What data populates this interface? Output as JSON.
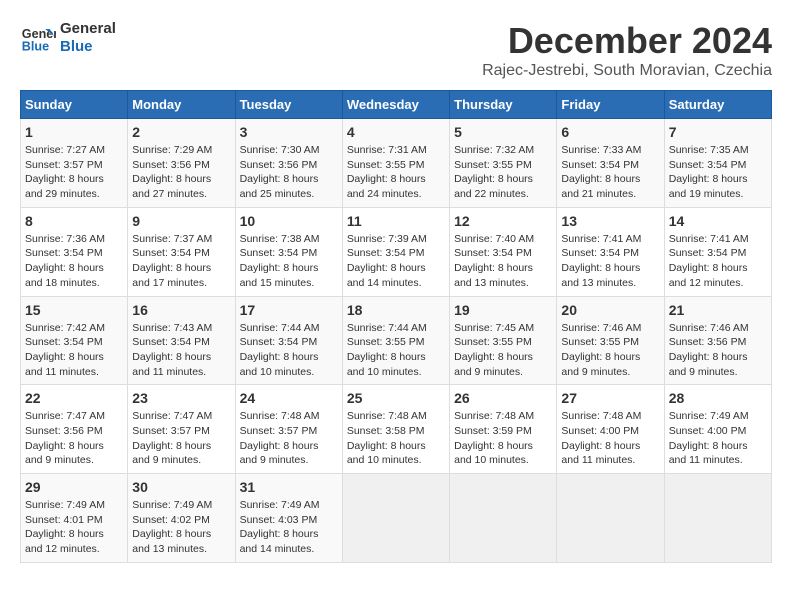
{
  "logo": {
    "line1": "General",
    "line2": "Blue"
  },
  "title": "December 2024",
  "location": "Rajec-Jestrebi, South Moravian, Czechia",
  "weekdays": [
    "Sunday",
    "Monday",
    "Tuesday",
    "Wednesday",
    "Thursday",
    "Friday",
    "Saturday"
  ],
  "weeks": [
    [
      {
        "day": "1",
        "rise": "7:27 AM",
        "set": "3:57 PM",
        "daylight": "8 hours and 29 minutes."
      },
      {
        "day": "2",
        "rise": "7:29 AM",
        "set": "3:56 PM",
        "daylight": "8 hours and 27 minutes."
      },
      {
        "day": "3",
        "rise": "7:30 AM",
        "set": "3:56 PM",
        "daylight": "8 hours and 25 minutes."
      },
      {
        "day": "4",
        "rise": "7:31 AM",
        "set": "3:55 PM",
        "daylight": "8 hours and 24 minutes."
      },
      {
        "day": "5",
        "rise": "7:32 AM",
        "set": "3:55 PM",
        "daylight": "8 hours and 22 minutes."
      },
      {
        "day": "6",
        "rise": "7:33 AM",
        "set": "3:54 PM",
        "daylight": "8 hours and 21 minutes."
      },
      {
        "day": "7",
        "rise": "7:35 AM",
        "set": "3:54 PM",
        "daylight": "8 hours and 19 minutes."
      }
    ],
    [
      {
        "day": "8",
        "rise": "7:36 AM",
        "set": "3:54 PM",
        "daylight": "8 hours and 18 minutes."
      },
      {
        "day": "9",
        "rise": "7:37 AM",
        "set": "3:54 PM",
        "daylight": "8 hours and 17 minutes."
      },
      {
        "day": "10",
        "rise": "7:38 AM",
        "set": "3:54 PM",
        "daylight": "8 hours and 15 minutes."
      },
      {
        "day": "11",
        "rise": "7:39 AM",
        "set": "3:54 PM",
        "daylight": "8 hours and 14 minutes."
      },
      {
        "day": "12",
        "rise": "7:40 AM",
        "set": "3:54 PM",
        "daylight": "8 hours and 13 minutes."
      },
      {
        "day": "13",
        "rise": "7:41 AM",
        "set": "3:54 PM",
        "daylight": "8 hours and 13 minutes."
      },
      {
        "day": "14",
        "rise": "7:41 AM",
        "set": "3:54 PM",
        "daylight": "8 hours and 12 minutes."
      }
    ],
    [
      {
        "day": "15",
        "rise": "7:42 AM",
        "set": "3:54 PM",
        "daylight": "8 hours and 11 minutes."
      },
      {
        "day": "16",
        "rise": "7:43 AM",
        "set": "3:54 PM",
        "daylight": "8 hours and 11 minutes."
      },
      {
        "day": "17",
        "rise": "7:44 AM",
        "set": "3:54 PM",
        "daylight": "8 hours and 10 minutes."
      },
      {
        "day": "18",
        "rise": "7:44 AM",
        "set": "3:55 PM",
        "daylight": "8 hours and 10 minutes."
      },
      {
        "day": "19",
        "rise": "7:45 AM",
        "set": "3:55 PM",
        "daylight": "8 hours and 9 minutes."
      },
      {
        "day": "20",
        "rise": "7:46 AM",
        "set": "3:55 PM",
        "daylight": "8 hours and 9 minutes."
      },
      {
        "day": "21",
        "rise": "7:46 AM",
        "set": "3:56 PM",
        "daylight": "8 hours and 9 minutes."
      }
    ],
    [
      {
        "day": "22",
        "rise": "7:47 AM",
        "set": "3:56 PM",
        "daylight": "8 hours and 9 minutes."
      },
      {
        "day": "23",
        "rise": "7:47 AM",
        "set": "3:57 PM",
        "daylight": "8 hours and 9 minutes."
      },
      {
        "day": "24",
        "rise": "7:48 AM",
        "set": "3:57 PM",
        "daylight": "8 hours and 9 minutes."
      },
      {
        "day": "25",
        "rise": "7:48 AM",
        "set": "3:58 PM",
        "daylight": "8 hours and 10 minutes."
      },
      {
        "day": "26",
        "rise": "7:48 AM",
        "set": "3:59 PM",
        "daylight": "8 hours and 10 minutes."
      },
      {
        "day": "27",
        "rise": "7:48 AM",
        "set": "4:00 PM",
        "daylight": "8 hours and 11 minutes."
      },
      {
        "day": "28",
        "rise": "7:49 AM",
        "set": "4:00 PM",
        "daylight": "8 hours and 11 minutes."
      }
    ],
    [
      {
        "day": "29",
        "rise": "7:49 AM",
        "set": "4:01 PM",
        "daylight": "8 hours and 12 minutes."
      },
      {
        "day": "30",
        "rise": "7:49 AM",
        "set": "4:02 PM",
        "daylight": "8 hours and 13 minutes."
      },
      {
        "day": "31",
        "rise": "7:49 AM",
        "set": "4:03 PM",
        "daylight": "8 hours and 14 minutes."
      },
      null,
      null,
      null,
      null
    ]
  ],
  "labels": {
    "sunrise": "Sunrise:",
    "sunset": "Sunset:",
    "daylight": "Daylight:"
  }
}
